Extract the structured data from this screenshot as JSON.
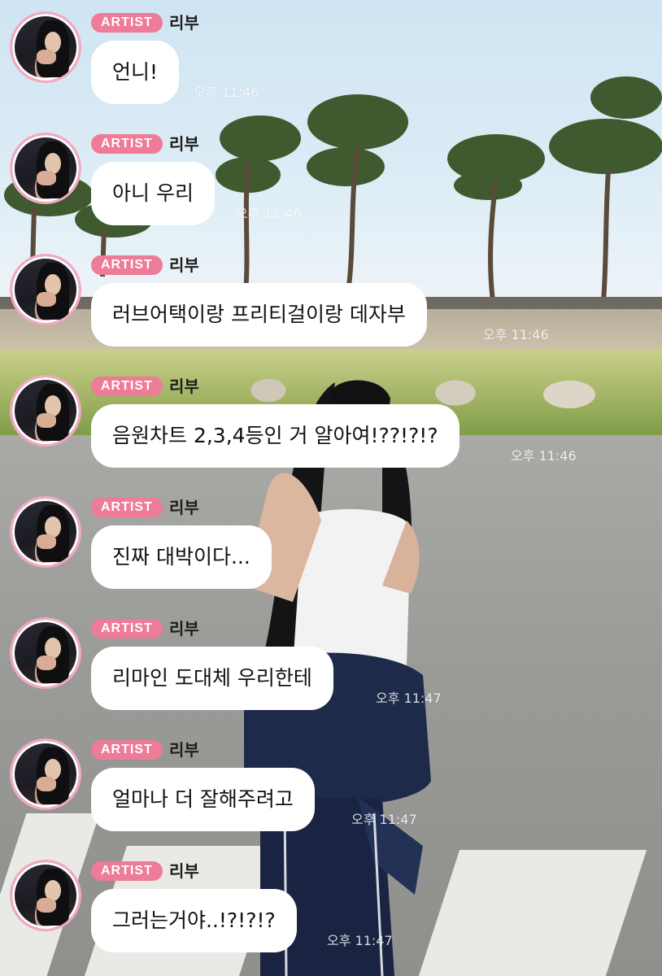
{
  "messages": [
    {
      "badge": "ARTIST",
      "sender": "리부",
      "text": "언니!",
      "time": "오후 11:46"
    },
    {
      "badge": "ARTIST",
      "sender": "리부",
      "text": "아니 우리",
      "time": "오후 11:46"
    },
    {
      "badge": "ARTIST",
      "sender": "리부",
      "text": "러브어택이랑 프리티걸이랑 데자부",
      "time": "오후 11:46"
    },
    {
      "badge": "ARTIST",
      "sender": "리부",
      "text": "음원차트 2,3,4등인 거 알아여!??!?!?",
      "time": "오후 11:46"
    },
    {
      "badge": "ARTIST",
      "sender": "리부",
      "text": "진짜 대박이다...",
      "time": "오후 11:47"
    },
    {
      "badge": "ARTIST",
      "sender": "리부",
      "text": "리마인 도대체 우리한테",
      "time": "오후 11:47"
    },
    {
      "badge": "ARTIST",
      "sender": "리부",
      "text": "얼마나 더 잘해주려고",
      "time": "오후 11:47"
    },
    {
      "badge": "ARTIST",
      "sender": "리부",
      "text": "그러는거야..!?!?!?",
      "time": "오후 11:47"
    }
  ],
  "colors": {
    "badge_bg": "#ee7b97",
    "avatar_ring": "#f3a9c3",
    "bubble_bg": "#ffffff"
  }
}
